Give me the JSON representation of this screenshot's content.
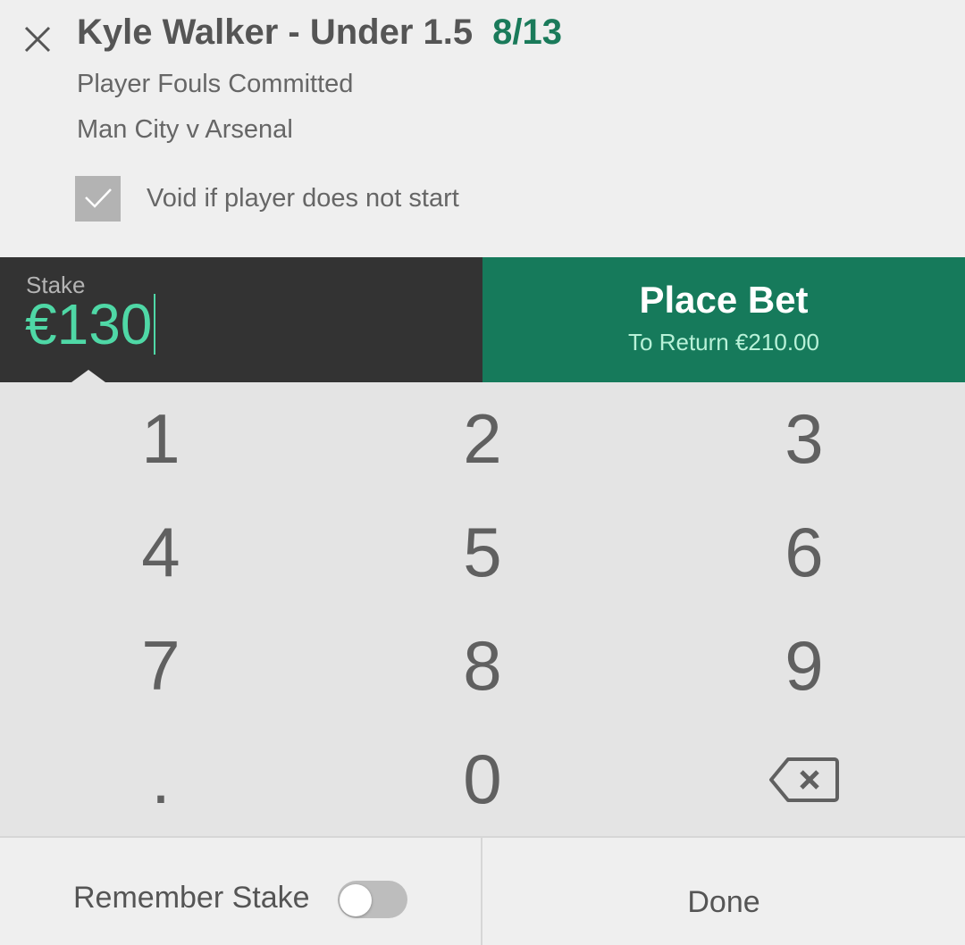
{
  "selection": {
    "close_icon": "close-icon",
    "title": "Kyle Walker - Under 1.5",
    "odds": "8/13",
    "market": "Player Fouls Committed",
    "event": "Man City v Arsenal",
    "void_checked": true,
    "void_label": "Void if player does not start"
  },
  "stake": {
    "label": "Stake",
    "value": "€130"
  },
  "place_bet": {
    "label": "Place Bet",
    "to_return": "To Return €210.00"
  },
  "keypad": {
    "keys": [
      "1",
      "2",
      "3",
      "4",
      "5",
      "6",
      "7",
      "8",
      "9",
      ".",
      "0"
    ],
    "backspace_icon": "backspace-icon"
  },
  "footer": {
    "remember_label": "Remember Stake",
    "remember_on": false,
    "done_label": "Done"
  },
  "colors": {
    "accent_green": "#167a5b",
    "odds_green": "#1a7a5a",
    "stake_text": "#4fd8a6",
    "stake_bg": "#333333"
  }
}
